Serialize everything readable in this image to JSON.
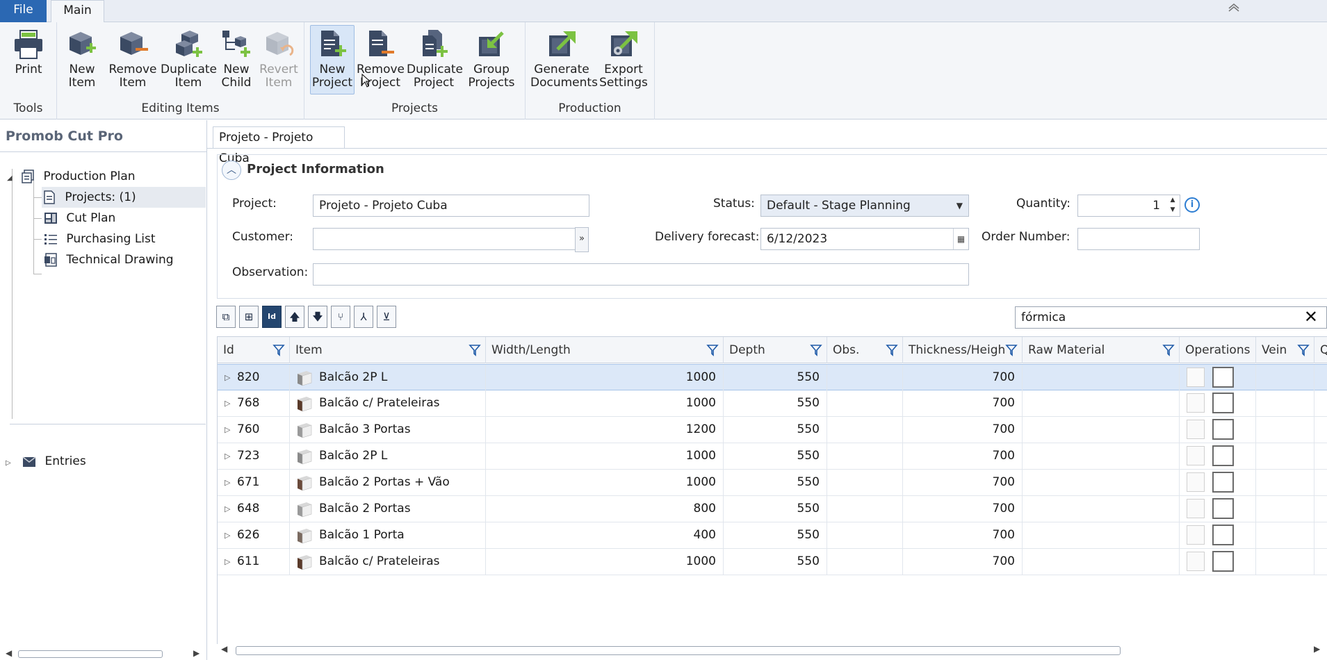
{
  "menu": {
    "file": "File",
    "main": "Main",
    "collapse_icon": "chevron-up-icon"
  },
  "ribbon": {
    "groups": {
      "tools": "Tools",
      "editing": "Editing Items",
      "projects": "Projects",
      "production": "Production"
    },
    "buttons": {
      "print": [
        "Print"
      ],
      "new_item": [
        "New",
        "Item"
      ],
      "remove_item": [
        "Remove",
        "Item"
      ],
      "duplicate_item": [
        "Duplicate",
        "Item"
      ],
      "new_child": [
        "New",
        "Child"
      ],
      "revert_item": [
        "Revert",
        "Item"
      ],
      "new_project": [
        "New",
        "Project"
      ],
      "remove_project": [
        "Remove",
        "Project"
      ],
      "duplicate_project": [
        "Duplicate",
        "Project"
      ],
      "group_projects": [
        "Group",
        "Projects"
      ],
      "generate_documents": [
        "Generate",
        "Documents"
      ],
      "export_settings": [
        "Export",
        "Settings"
      ]
    },
    "colors": {
      "accent_blue": "#2b68b3",
      "add_green": "#7cc242",
      "box_navy": "#3b4a63"
    }
  },
  "sidebar": {
    "title": "Promob Cut Pro",
    "tree": {
      "production_plan": "Production Plan",
      "projects": "Projects: (1)",
      "cut_plan": "Cut Plan",
      "purchasing_list": "Purchasing List",
      "technical_drawing": "Technical Drawing",
      "entries": "Entries"
    }
  },
  "document": {
    "tab": "Projeto - Projeto Cuba",
    "section_title": "Project Information",
    "fields": {
      "project_label": "Project:",
      "project_value": "Projeto - Projeto Cuba",
      "customer_label": "Customer:",
      "customer_value": "",
      "observation_label": "Observation:",
      "observation_value": "",
      "status_label": "Status:",
      "status_value": "Default - Stage Planning",
      "delivery_label": "Delivery forecast:",
      "delivery_value": "6/12/2023",
      "quantity_label": "Quantity:",
      "quantity_value": "1",
      "order_label": "Order Number:",
      "order_value": ""
    }
  },
  "search": {
    "value": "fórmica"
  },
  "grid": {
    "columns": {
      "id": "Id",
      "item": "Item",
      "width": "Width/Length",
      "depth": "Depth",
      "obs": "Obs.",
      "thickness": "Thickness/Height",
      "raw": "Raw Material",
      "operations": "Operations",
      "vein": "Vein",
      "qty": "Quantity"
    },
    "rows": [
      {
        "id": "820",
        "item": "Balcão 2P L",
        "width": "1000",
        "depth": "550",
        "thickness": "700"
      },
      {
        "id": "768",
        "item": "Balcão c/ Prateleiras",
        "width": "1000",
        "depth": "550",
        "thickness": "700"
      },
      {
        "id": "760",
        "item": "Balcão 3 Portas",
        "width": "1200",
        "depth": "550",
        "thickness": "700"
      },
      {
        "id": "723",
        "item": "Balcão 2P L",
        "width": "1000",
        "depth": "550",
        "thickness": "700"
      },
      {
        "id": "671",
        "item": "Balcão 2 Portas + Vão",
        "width": "1000",
        "depth": "550",
        "thickness": "700"
      },
      {
        "id": "648",
        "item": "Balcão 2 Portas",
        "width": "800",
        "depth": "550",
        "thickness": "700"
      },
      {
        "id": "626",
        "item": "Balcão 1 Porta",
        "width": "400",
        "depth": "550",
        "thickness": "700"
      },
      {
        "id": "611",
        "item": "Balcão c/ Prateleiras",
        "width": "1000",
        "depth": "550",
        "thickness": "700"
      }
    ]
  }
}
